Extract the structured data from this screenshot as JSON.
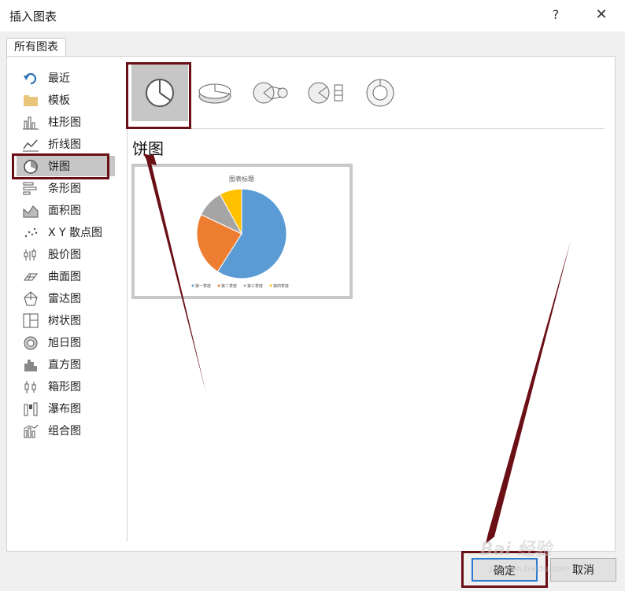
{
  "window": {
    "title": "插入图表",
    "help": "?",
    "close": "✕"
  },
  "tabs": [
    {
      "label": "所有图表"
    }
  ],
  "sidebar": {
    "items": [
      {
        "label": "最近",
        "icon": "undo-icon"
      },
      {
        "label": "模板",
        "icon": "folder-icon"
      },
      {
        "label": "柱形图",
        "icon": "column-chart-icon"
      },
      {
        "label": "折线图",
        "icon": "line-chart-icon"
      },
      {
        "label": "饼图",
        "icon": "pie-chart-icon",
        "selected": true
      },
      {
        "label": "条形图",
        "icon": "bar-chart-icon"
      },
      {
        "label": "面积图",
        "icon": "area-chart-icon"
      },
      {
        "label": "X Y 散点图",
        "icon": "scatter-chart-icon"
      },
      {
        "label": "股价图",
        "icon": "stock-chart-icon"
      },
      {
        "label": "曲面图",
        "icon": "surface-chart-icon"
      },
      {
        "label": "雷达图",
        "icon": "radar-chart-icon"
      },
      {
        "label": "树状图",
        "icon": "treemap-chart-icon"
      },
      {
        "label": "旭日图",
        "icon": "sunburst-chart-icon"
      },
      {
        "label": "直方图",
        "icon": "histogram-chart-icon"
      },
      {
        "label": "箱形图",
        "icon": "boxwhisker-chart-icon"
      },
      {
        "label": "瀑布图",
        "icon": "waterfall-chart-icon"
      },
      {
        "label": "组合图",
        "icon": "combo-chart-icon"
      }
    ]
  },
  "subtypes": [
    {
      "icon": "pie-icon",
      "selected": true
    },
    {
      "icon": "pie-3d-icon"
    },
    {
      "icon": "pie-of-pie-icon"
    },
    {
      "icon": "bar-of-pie-icon"
    },
    {
      "icon": "doughnut-icon"
    }
  ],
  "subtype_title": "饼图",
  "preview": {
    "chart_title": "图表标题",
    "legend": [
      "第一季度",
      "第二季度",
      "第三季度",
      "第四季度"
    ]
  },
  "chart_data": {
    "type": "pie",
    "title": "图表标题",
    "categories": [
      "第一季度",
      "第二季度",
      "第三季度",
      "第四季度"
    ],
    "values": [
      59,
      23,
      10,
      8
    ],
    "colors": [
      "#5b9bd5",
      "#ed7d31",
      "#a5a5a5",
      "#ffc000"
    ],
    "legend_position": "bottom"
  },
  "buttons": {
    "ok": "确定",
    "cancel": "取消"
  },
  "watermark": {
    "text": "Bai 经验",
    "url": "jingyan.baidu.com"
  },
  "colors": {
    "highlight": "#6b0f16",
    "selection": "#c6c6c6",
    "primary_border": "#2b7bd0"
  }
}
